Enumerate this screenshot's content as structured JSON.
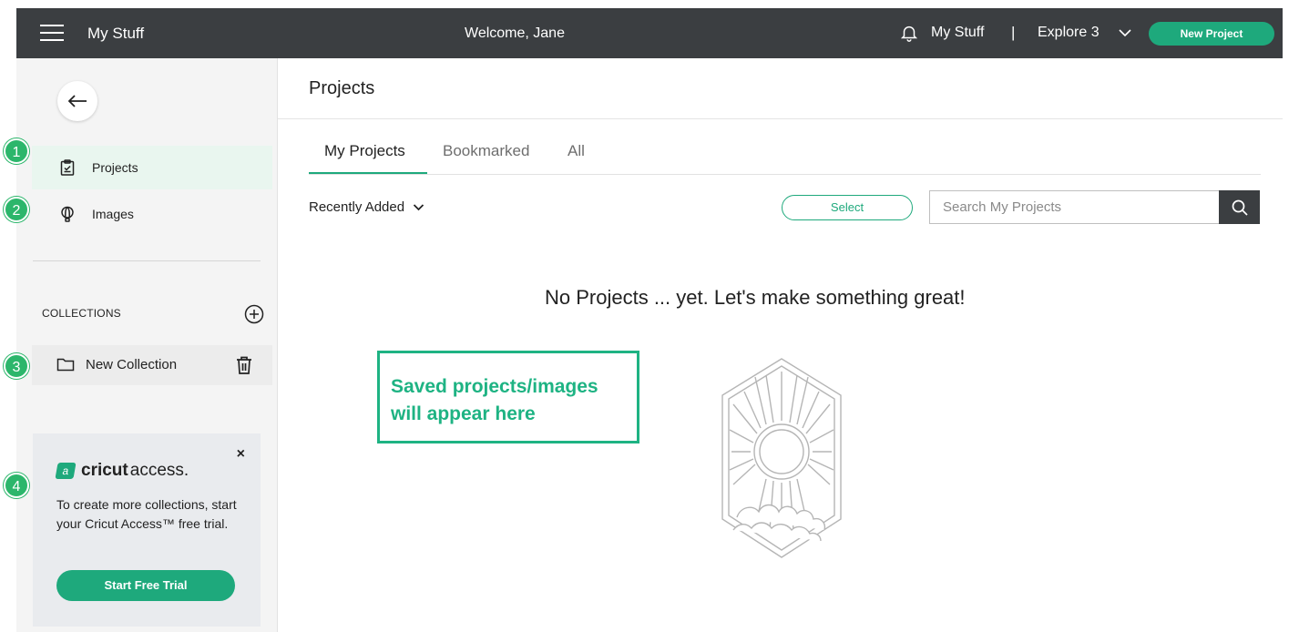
{
  "topbar": {
    "brand": "My Stuff",
    "welcome": "Welcome, Jane",
    "nav_mystuff": "My Stuff",
    "separator": "|",
    "nav_explore": "Explore 3",
    "new_project_label": "New Project"
  },
  "sidebar": {
    "items": [
      {
        "label": "Projects",
        "icon": "clipboard-icon",
        "active": true
      },
      {
        "label": "Images",
        "icon": "balloon-icon",
        "active": false
      }
    ],
    "collections_title": "COLLECTIONS",
    "collections": [
      {
        "label": "New Collection"
      }
    ],
    "promo": {
      "logo_bold": "cricut",
      "logo_light": "access.",
      "text": "To create more collections, start your Cricut Access™ free trial.",
      "button_label": "Start Free Trial",
      "close": "×"
    }
  },
  "markers": [
    "1",
    "2",
    "3",
    "4"
  ],
  "main": {
    "title": "Projects",
    "tabs": [
      {
        "label": "My Projects",
        "active": true
      },
      {
        "label": "Bookmarked",
        "active": false
      },
      {
        "label": "All",
        "active": false
      }
    ],
    "sort_label": "Recently Added",
    "select_label": "Select",
    "search_placeholder": "Search My Projects",
    "empty_message": "No Projects ... yet. Let's make something great!",
    "annotation_line1": "Saved projects/images",
    "annotation_line2": "will appear here"
  },
  "colors": {
    "topbar": "#3b3e41",
    "accent": "#1ea97c",
    "marker": "#2cb66b",
    "annotation": "#1eb383"
  }
}
